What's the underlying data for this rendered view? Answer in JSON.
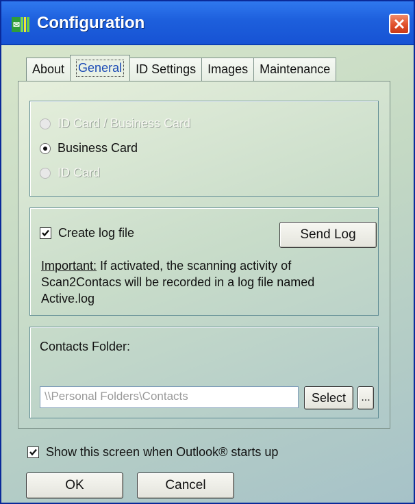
{
  "window": {
    "title": "Configuration"
  },
  "tabs": [
    {
      "label": "About",
      "active": false
    },
    {
      "label": "General",
      "active": true
    },
    {
      "label": "ID Settings",
      "active": false
    },
    {
      "label": "Images",
      "active": false
    },
    {
      "label": "Maintenance",
      "active": false
    }
  ],
  "card_type": {
    "options": [
      {
        "label": "ID Card / Business Card",
        "selected": false,
        "enabled": false
      },
      {
        "label": "Business Card",
        "selected": true,
        "enabled": true
      },
      {
        "label": "ID Card",
        "selected": false,
        "enabled": false
      }
    ]
  },
  "log": {
    "checkbox_label": "Create log file",
    "checked": true,
    "send_button": "Send Log",
    "note_label": "Important:",
    "note_text": " If activated, the scanning activity of Scan2Contacs will be recorded in a log file named Active.log"
  },
  "contacts": {
    "label": "Contacts Folder:",
    "path_value": "\\\\Personal Folders\\Contacts",
    "select_button": "Select",
    "browse_button": "..."
  },
  "startup": {
    "checkbox_label": "Show this screen when Outlook® starts up",
    "checked": true
  },
  "footer": {
    "ok_button": "OK",
    "cancel_button": "Cancel"
  },
  "colors": {
    "titlebar": "#1d5fdc",
    "close": "#e0502a",
    "panel_border": "#5d8a93"
  },
  "icons": [
    "app-icon",
    "close-icon",
    "radio-icon",
    "checkbox-icon"
  ]
}
